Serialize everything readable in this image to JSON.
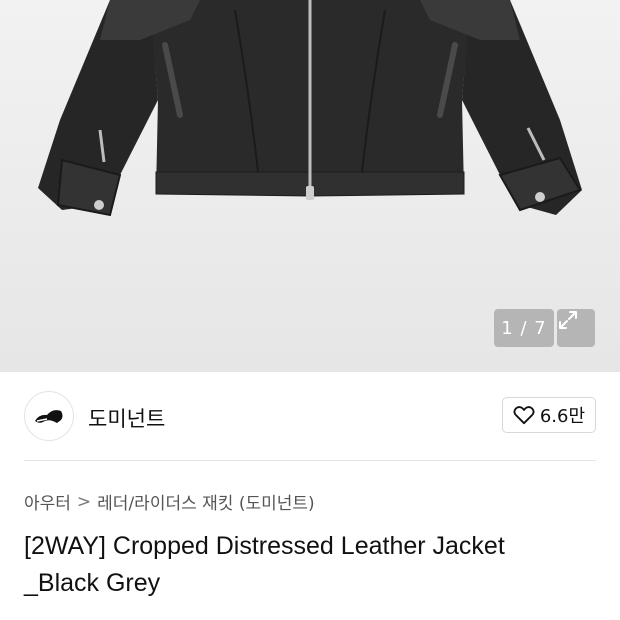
{
  "gallery": {
    "counter": "1 / 7",
    "expand_icon": "expand-arrows-icon",
    "background": "#ececec"
  },
  "brand": {
    "name": "도미넌트",
    "logo_icon": "brand-logo-icon"
  },
  "like": {
    "icon": "heart-outline-icon",
    "count": "6.6만"
  },
  "breadcrumb": {
    "category": "아우터",
    "separator": ">",
    "subcategory": "레더/라이더스 재킷 (도미넌트)"
  },
  "product": {
    "title_line1": "[2WAY] Cropped Distressed Leather Jacket",
    "title_line2": "_Black Grey"
  }
}
